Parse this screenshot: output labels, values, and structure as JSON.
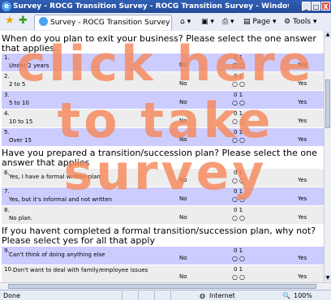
{
  "window": {
    "title": "Survey - ROCG Transition Survey - ROCG Transition Survey - Windows Internet Explorer",
    "min_glyph": "_",
    "max_glyph": "□",
    "close_glyph": "X"
  },
  "toolbar": {
    "tab_label": "Survey - ROCG Transition Survey - RO...",
    "page_label": "Page",
    "tools_label": "Tools"
  },
  "survey": {
    "questions": [
      {
        "text": "When do you plan to exit your business? Please select the one answer that applies.",
        "rows": [
          {
            "num": "1.",
            "label": "Under 2 years",
            "no": "No",
            "scale": "0 1",
            "yes": "Yes"
          },
          {
            "num": "2.",
            "label": "2 to 5",
            "no": "No",
            "scale": "0 1",
            "yes": "Yes"
          },
          {
            "num": "3.",
            "label": "5 to 10",
            "no": "No",
            "scale": "0 1",
            "yes": "Yes"
          },
          {
            "num": "4.",
            "label": "10 to 15",
            "no": "No",
            "scale": "0 1",
            "yes": "Yes"
          },
          {
            "num": "5.",
            "label": "Over 15",
            "no": "No",
            "scale": "0 1",
            "yes": "Yes"
          }
        ]
      },
      {
        "text": "Have you prepared a transition/succession plan? Please select the one answer that applies",
        "rows": [
          {
            "num": "6.",
            "label": "Yes, I have a formal written plan",
            "no": "No",
            "scale": "0 1",
            "yes": "Yes"
          },
          {
            "num": "7.",
            "label": "Yes, but it's informal and not written",
            "no": "No",
            "scale": "0 1",
            "yes": "Yes"
          },
          {
            "num": "8.",
            "label": "No plan.",
            "no": "No",
            "scale": "0 1",
            "yes": "Yes"
          }
        ]
      },
      {
        "text": "If you havent completed a formal transition/succession plan, why not? Please select yes for all that apply",
        "rows": [
          {
            "num": "9.",
            "label": "Can't think of doing anything else",
            "no": "No",
            "scale": "0 1",
            "yes": "Yes"
          },
          {
            "num": "10.",
            "label": "Don't want to deal with family/employee issues",
            "no": "No",
            "scale": "0 1",
            "yes": "Yes"
          }
        ]
      }
    ]
  },
  "overlay": {
    "line1": "click here",
    "line2": "to take",
    "line3": "survey"
  },
  "status": {
    "left": "Done",
    "zone": "Internet",
    "zoom": "100%"
  },
  "colors": {
    "row_blue": "#ccccff",
    "row_grey": "#ededed",
    "overlay": "#f5875a"
  }
}
